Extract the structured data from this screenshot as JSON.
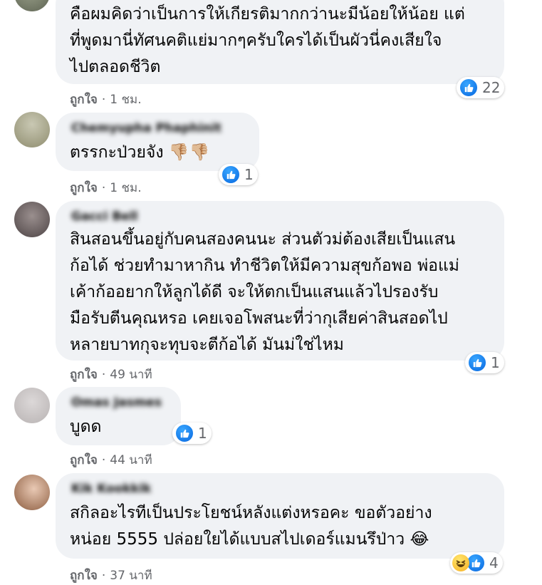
{
  "comments": [
    {
      "text": "คือผมคิดว่าเป็นการให้เกียรติมากกว่านะมีน้อยให้น้อย แต่\nที่พูดมานี่ทัศนคติแย่มากๆครับใครได้เป็นผัวนี่คงเสียใจ\nไปตลอดชีวิต",
      "reaction_count": "22",
      "like_label": "ถูกใจ",
      "time": "1 ชม."
    },
    {
      "author": "Chemyupha Phaphinit",
      "text": "ตรรกะป่วยจัง 👎🏼👎🏼",
      "reaction_count": "1",
      "like_label": "ถูกใจ",
      "time": "1 ชม."
    },
    {
      "author": "Gacci Bell",
      "text": "สินสอนขึ้นอยู่กับคนสองคนนะ ส่วนตัวม่ต้องเสียเป็นแสน\nก้อได้ ช่วยทำมาหากิน ทำชีวิตให้มีความสุขก้อพอ พ่อแม่\nเค้าก้ออยากให้ลูกได้ดี จะให้ตกเป็นแสนแล้วไปรองรับ\nมือรับตีนคุณหรอ เคยเจอโพสนะที่ว่ากุเสียค่าสินสอดไป\nหลายบาทกุจะทุบจะตีก้อได้ มันม่ใช่ไหม",
      "reaction_count": "1",
      "like_label": "ถูกใจ",
      "time": "49 นาที"
    },
    {
      "author": "Omas Jasmes",
      "text": "บูดด",
      "reaction_count": "1",
      "like_label": "ถูกใจ",
      "time": "44 นาที"
    },
    {
      "author": "Kik Kookkik",
      "text": "สกิลอะไรทีเป็นประโยชน์หลังแต่งหรอคะ ขอตัวอย่าง\nหน่อย 5555 ปล่อยใยได้แบบสไปเดอร์แมนรึป่าว 😂",
      "reaction_count": "4",
      "like_label": "ถูกใจ",
      "time": "37 นาที"
    }
  ],
  "separator": "·",
  "colors": {
    "bubble": "#f0f2f5",
    "like_blue": "#1877f2",
    "meta_text": "#65676b"
  },
  "icons": {
    "like": "like-icon",
    "haha": "haha-icon"
  }
}
